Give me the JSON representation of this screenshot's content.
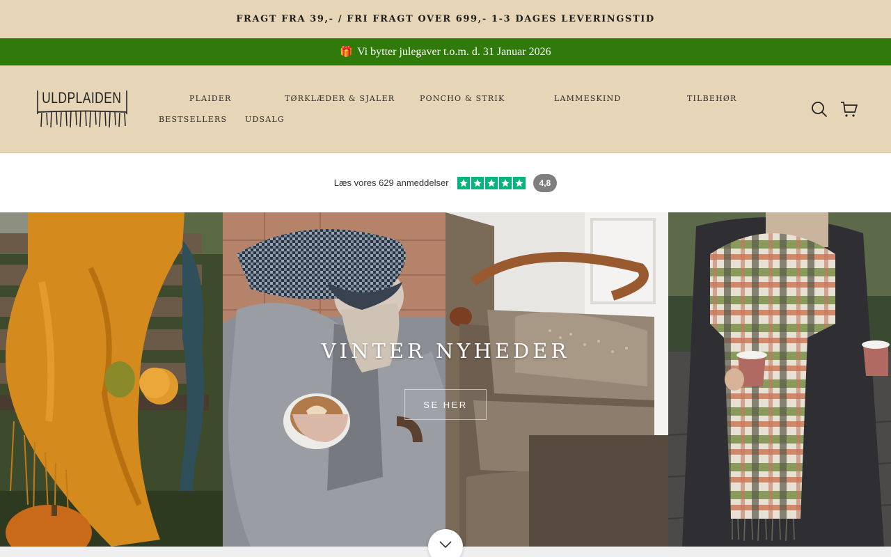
{
  "announcement": {
    "shipping_text": "FRAGT FRA 39,- / FRI FRAGT OVER 699,- 1-3 DAGES LEVERINGSTID",
    "promo_icon": "🎁",
    "promo_text": "Vi bytter julegaver t.o.m. d. 31 Januar 2026"
  },
  "header": {
    "logo_text": "ULDPLAIDEN",
    "nav": [
      {
        "label": "PLAIDER"
      },
      {
        "label": "TØRKLÆDER & SJALER"
      },
      {
        "label": "PONCHO & STRIK"
      },
      {
        "label": "LAMMESKIND"
      },
      {
        "label": "TILBEHØR"
      },
      {
        "label": "BESTSELLERS"
      },
      {
        "label": "UDSALG"
      }
    ],
    "icons": [
      "search-icon",
      "cart-icon"
    ]
  },
  "reviews": {
    "text": "Læs vores 629 anmeddelser",
    "stars": 5,
    "rating": "4,8",
    "star_color": "#00b67a"
  },
  "hero": {
    "title": "VINTER NYHEDER",
    "button_label": "SE HER",
    "scroll_icon": "chevron-down-icon"
  },
  "colors": {
    "beige": "#e6d6b7",
    "green": "#2f7a0a"
  }
}
